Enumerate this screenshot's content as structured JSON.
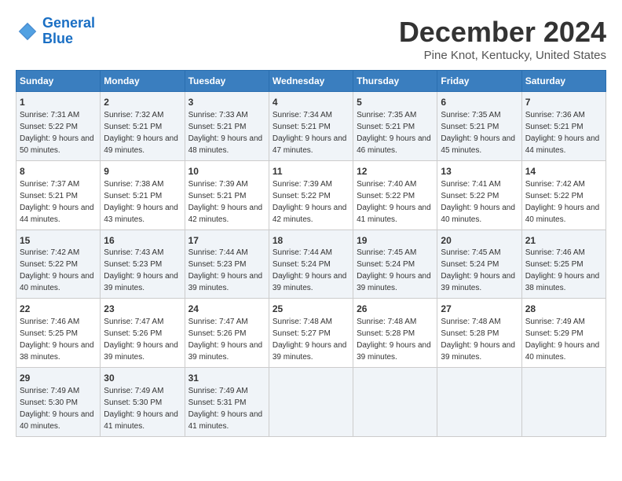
{
  "logo": {
    "line1": "General",
    "line2": "Blue"
  },
  "title": "December 2024",
  "subtitle": "Pine Knot, Kentucky, United States",
  "days_header": [
    "Sunday",
    "Monday",
    "Tuesday",
    "Wednesday",
    "Thursday",
    "Friday",
    "Saturday"
  ],
  "weeks": [
    [
      {
        "day": "1",
        "sunrise": "Sunrise: 7:31 AM",
        "sunset": "Sunset: 5:22 PM",
        "daylight": "Daylight: 9 hours and 50 minutes."
      },
      {
        "day": "2",
        "sunrise": "Sunrise: 7:32 AM",
        "sunset": "Sunset: 5:21 PM",
        "daylight": "Daylight: 9 hours and 49 minutes."
      },
      {
        "day": "3",
        "sunrise": "Sunrise: 7:33 AM",
        "sunset": "Sunset: 5:21 PM",
        "daylight": "Daylight: 9 hours and 48 minutes."
      },
      {
        "day": "4",
        "sunrise": "Sunrise: 7:34 AM",
        "sunset": "Sunset: 5:21 PM",
        "daylight": "Daylight: 9 hours and 47 minutes."
      },
      {
        "day": "5",
        "sunrise": "Sunrise: 7:35 AM",
        "sunset": "Sunset: 5:21 PM",
        "daylight": "Daylight: 9 hours and 46 minutes."
      },
      {
        "day": "6",
        "sunrise": "Sunrise: 7:35 AM",
        "sunset": "Sunset: 5:21 PM",
        "daylight": "Daylight: 9 hours and 45 minutes."
      },
      {
        "day": "7",
        "sunrise": "Sunrise: 7:36 AM",
        "sunset": "Sunset: 5:21 PM",
        "daylight": "Daylight: 9 hours and 44 minutes."
      }
    ],
    [
      {
        "day": "8",
        "sunrise": "Sunrise: 7:37 AM",
        "sunset": "Sunset: 5:21 PM",
        "daylight": "Daylight: 9 hours and 44 minutes."
      },
      {
        "day": "9",
        "sunrise": "Sunrise: 7:38 AM",
        "sunset": "Sunset: 5:21 PM",
        "daylight": "Daylight: 9 hours and 43 minutes."
      },
      {
        "day": "10",
        "sunrise": "Sunrise: 7:39 AM",
        "sunset": "Sunset: 5:21 PM",
        "daylight": "Daylight: 9 hours and 42 minutes."
      },
      {
        "day": "11",
        "sunrise": "Sunrise: 7:39 AM",
        "sunset": "Sunset: 5:22 PM",
        "daylight": "Daylight: 9 hours and 42 minutes."
      },
      {
        "day": "12",
        "sunrise": "Sunrise: 7:40 AM",
        "sunset": "Sunset: 5:22 PM",
        "daylight": "Daylight: 9 hours and 41 minutes."
      },
      {
        "day": "13",
        "sunrise": "Sunrise: 7:41 AM",
        "sunset": "Sunset: 5:22 PM",
        "daylight": "Daylight: 9 hours and 40 minutes."
      },
      {
        "day": "14",
        "sunrise": "Sunrise: 7:42 AM",
        "sunset": "Sunset: 5:22 PM",
        "daylight": "Daylight: 9 hours and 40 minutes."
      }
    ],
    [
      {
        "day": "15",
        "sunrise": "Sunrise: 7:42 AM",
        "sunset": "Sunset: 5:22 PM",
        "daylight": "Daylight: 9 hours and 40 minutes."
      },
      {
        "day": "16",
        "sunrise": "Sunrise: 7:43 AM",
        "sunset": "Sunset: 5:23 PM",
        "daylight": "Daylight: 9 hours and 39 minutes."
      },
      {
        "day": "17",
        "sunrise": "Sunrise: 7:44 AM",
        "sunset": "Sunset: 5:23 PM",
        "daylight": "Daylight: 9 hours and 39 minutes."
      },
      {
        "day": "18",
        "sunrise": "Sunrise: 7:44 AM",
        "sunset": "Sunset: 5:24 PM",
        "daylight": "Daylight: 9 hours and 39 minutes."
      },
      {
        "day": "19",
        "sunrise": "Sunrise: 7:45 AM",
        "sunset": "Sunset: 5:24 PM",
        "daylight": "Daylight: 9 hours and 39 minutes."
      },
      {
        "day": "20",
        "sunrise": "Sunrise: 7:45 AM",
        "sunset": "Sunset: 5:24 PM",
        "daylight": "Daylight: 9 hours and 39 minutes."
      },
      {
        "day": "21",
        "sunrise": "Sunrise: 7:46 AM",
        "sunset": "Sunset: 5:25 PM",
        "daylight": "Daylight: 9 hours and 38 minutes."
      }
    ],
    [
      {
        "day": "22",
        "sunrise": "Sunrise: 7:46 AM",
        "sunset": "Sunset: 5:25 PM",
        "daylight": "Daylight: 9 hours and 38 minutes."
      },
      {
        "day": "23",
        "sunrise": "Sunrise: 7:47 AM",
        "sunset": "Sunset: 5:26 PM",
        "daylight": "Daylight: 9 hours and 39 minutes."
      },
      {
        "day": "24",
        "sunrise": "Sunrise: 7:47 AM",
        "sunset": "Sunset: 5:26 PM",
        "daylight": "Daylight: 9 hours and 39 minutes."
      },
      {
        "day": "25",
        "sunrise": "Sunrise: 7:48 AM",
        "sunset": "Sunset: 5:27 PM",
        "daylight": "Daylight: 9 hours and 39 minutes."
      },
      {
        "day": "26",
        "sunrise": "Sunrise: 7:48 AM",
        "sunset": "Sunset: 5:28 PM",
        "daylight": "Daylight: 9 hours and 39 minutes."
      },
      {
        "day": "27",
        "sunrise": "Sunrise: 7:48 AM",
        "sunset": "Sunset: 5:28 PM",
        "daylight": "Daylight: 9 hours and 39 minutes."
      },
      {
        "day": "28",
        "sunrise": "Sunrise: 7:49 AM",
        "sunset": "Sunset: 5:29 PM",
        "daylight": "Daylight: 9 hours and 40 minutes."
      }
    ],
    [
      {
        "day": "29",
        "sunrise": "Sunrise: 7:49 AM",
        "sunset": "Sunset: 5:30 PM",
        "daylight": "Daylight: 9 hours and 40 minutes."
      },
      {
        "day": "30",
        "sunrise": "Sunrise: 7:49 AM",
        "sunset": "Sunset: 5:30 PM",
        "daylight": "Daylight: 9 hours and 41 minutes."
      },
      {
        "day": "31",
        "sunrise": "Sunrise: 7:49 AM",
        "sunset": "Sunset: 5:31 PM",
        "daylight": "Daylight: 9 hours and 41 minutes."
      },
      null,
      null,
      null,
      null
    ]
  ]
}
